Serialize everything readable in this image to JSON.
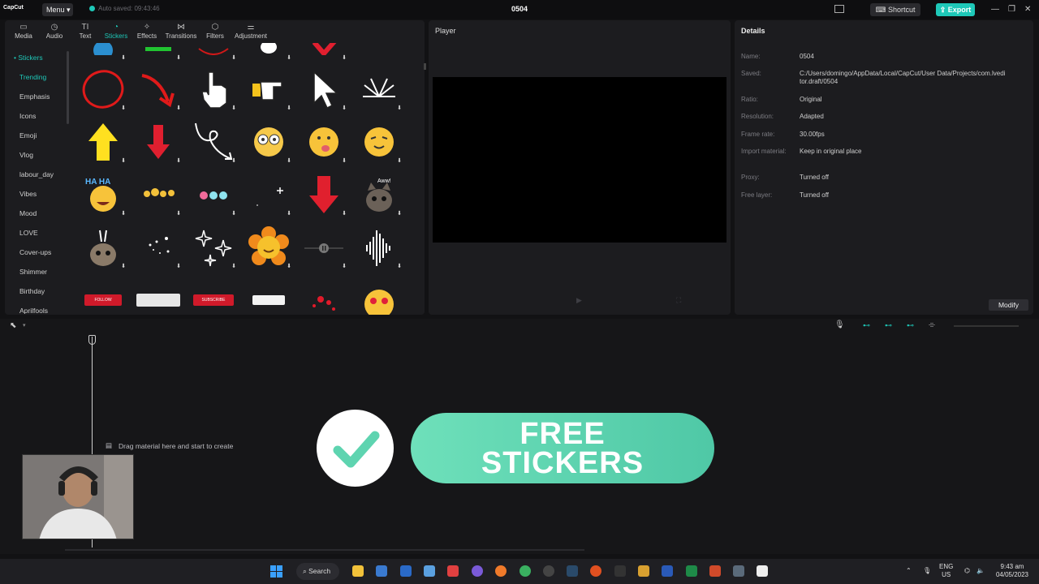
{
  "titlebar": {
    "logo": "CapCut",
    "menu_label": "Menu",
    "autosave": "Auto saved: 09:43:46",
    "project_title": "0504",
    "shortcut_label": "Shortcut",
    "export_label": "Export"
  },
  "toolbar": [
    {
      "label": "Media",
      "icon": "media-icon"
    },
    {
      "label": "Audio",
      "icon": "audio-icon"
    },
    {
      "label": "Text",
      "icon": "text-icon"
    },
    {
      "label": "Stickers",
      "icon": "stickers-icon"
    },
    {
      "label": "Effects",
      "icon": "effects-icon"
    },
    {
      "label": "Transitions",
      "icon": "transitions-icon"
    },
    {
      "label": "Filters",
      "icon": "filters-icon"
    },
    {
      "label": "Adjustment",
      "icon": "adjustment-icon"
    }
  ],
  "categories": {
    "header": "Stickers",
    "items": [
      "Trending",
      "Emphasis",
      "Icons",
      "Emoji",
      "Vlog",
      "labour_day",
      "Vibes",
      "Mood",
      "LOVE",
      "Cover-ups",
      "Shimmer",
      "Birthday",
      "Aprilfools"
    ]
  },
  "sticker_badges": {
    "follow": "FOLLOW",
    "subscribe": "SUBSCRIBE"
  },
  "player": {
    "title": "Player"
  },
  "details": {
    "title": "Details",
    "rows": [
      {
        "key": "Name:",
        "value": "0504"
      },
      {
        "key": "Saved:",
        "value": "C:/Users/domingo/AppData/Local/CapCut/User Data/Projects/com.lveditor.draft/0504"
      },
      {
        "key": "Ratio:",
        "value": "Original"
      },
      {
        "key": "Resolution:",
        "value": "Adapted"
      },
      {
        "key": "Frame rate:",
        "value": "30.00fps"
      },
      {
        "key": "Import material:",
        "value": "Keep in original place"
      },
      {
        "key": "Proxy:",
        "value": "Turned off"
      },
      {
        "key": "Free layer:",
        "value": "Turned off"
      }
    ],
    "modify_label": "Modify"
  },
  "timeline": {
    "drag_hint": "Drag material here and start to create"
  },
  "banner": {
    "text": "FREE\nSTICKERS"
  },
  "taskbar": {
    "search_label": "Search",
    "lang_top": "ENG",
    "lang_bottom": "US",
    "time": "9:43 am",
    "date": "04/05/2023"
  },
  "colors": {
    "accent": "#1ec8b8",
    "banner_green": "#5ed4b0"
  }
}
